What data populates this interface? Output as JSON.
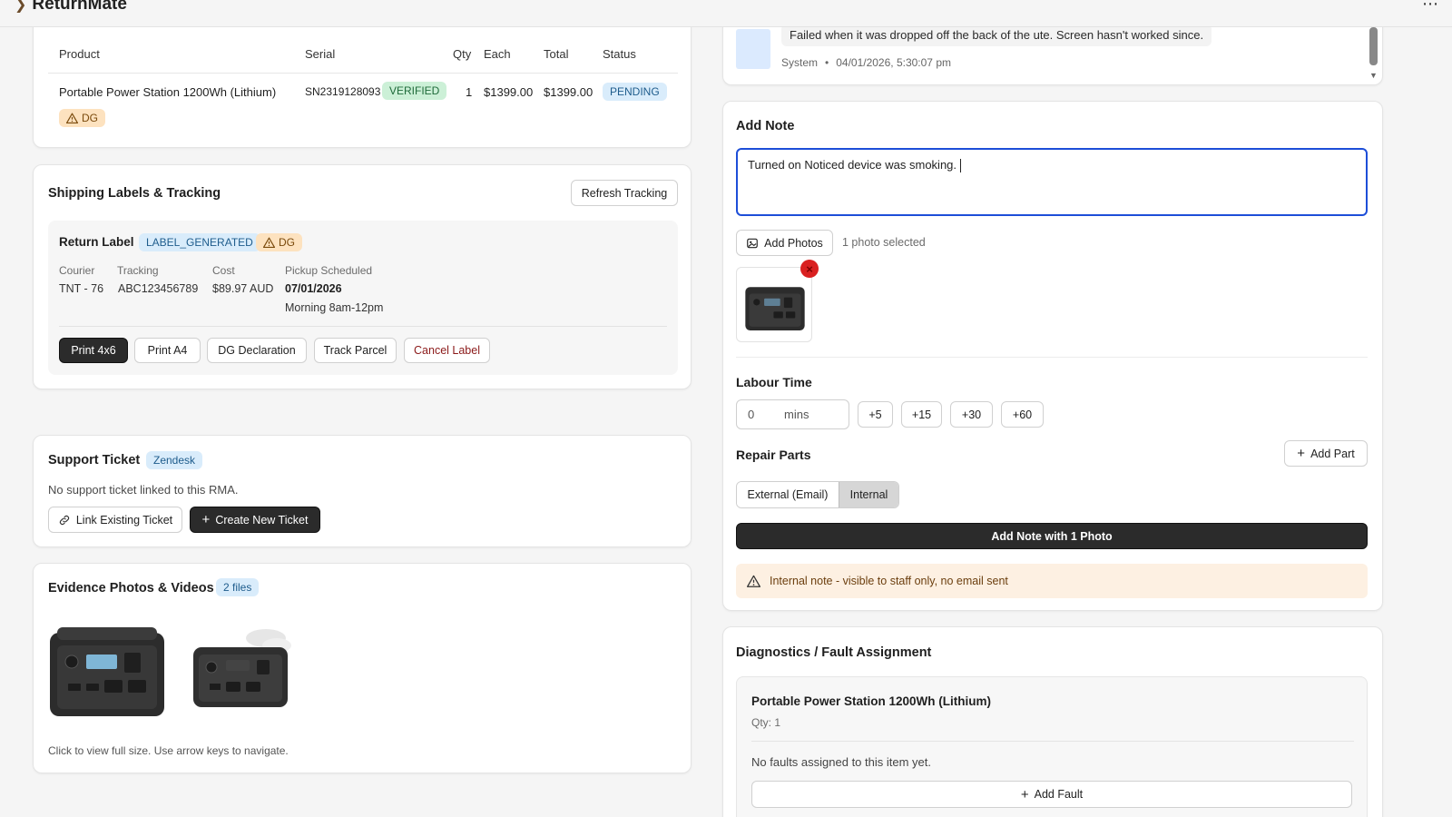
{
  "app": {
    "brand": "ReturnMate"
  },
  "products_table": {
    "headers": [
      "Product",
      "Serial",
      "Qty",
      "Each",
      "Total",
      "Status"
    ],
    "row": {
      "product": "Portable Power Station 1200Wh (Lithium)",
      "serial": "SN2319128093",
      "serial_badge": "VERIFIED",
      "qty": "1",
      "each": "$1399.00",
      "total": "$1399.00",
      "status": "PENDING",
      "dg_badge": "DG"
    }
  },
  "shipping": {
    "title": "Shipping Labels & Tracking",
    "refresh_label": "Refresh Tracking",
    "label_title": "Return Label",
    "label_status": "LABEL_GENERATED",
    "dg_badge": "DG",
    "courier_label": "Courier",
    "courier_value": "TNT - 76",
    "tracking_label": "Tracking",
    "tracking_value": "ABC123456789",
    "cost_label": "Cost",
    "cost_value": "$89.97 AUD",
    "pickup_label": "Pickup Scheduled",
    "pickup_date": "07/01/2026",
    "pickup_window": "Morning 8am-12pm",
    "buttons": {
      "print_4x6": "Print 4x6",
      "print_a4": "Print A4",
      "dg_declaration": "DG Declaration",
      "track_parcel": "Track Parcel",
      "cancel_label": "Cancel Label"
    },
    "cancel_color": "#8b1a1a"
  },
  "support": {
    "title": "Support Ticket",
    "badge": "Zendesk",
    "empty_text": "No support ticket linked to this RMA.",
    "link_label": "Link Existing Ticket",
    "create_label": "Create New Ticket"
  },
  "evidence": {
    "title": "Evidence Photos & Videos",
    "badge": "2 files",
    "hint": "Click to view full size. Use arrow keys to navigate."
  },
  "history": {
    "message": "Failed when it was dropped off the back of the ute. Screen hasn't worked since.",
    "author": "System",
    "separator": "•",
    "timestamp": "04/01/2026, 5:30:07 pm"
  },
  "add_note": {
    "title": "Add Note",
    "textarea_value": "Turned on Noticed device was smoking. ",
    "add_photos_label": "Add Photos",
    "photos_selected": "1 photo selected",
    "labour_title": "Labour Time",
    "labour_value": "0",
    "labour_unit": "mins",
    "increments": [
      "+5",
      "+15",
      "+30",
      "+60"
    ],
    "repair_parts_title": "Repair Parts",
    "add_part_label": "Add Part",
    "visibility_options": [
      "External (Email)",
      "Internal"
    ],
    "visibility_selected": "Internal",
    "submit_label": "Add Note with 1 Photo",
    "warning_text": "Internal note - visible to staff only, no email sent"
  },
  "diagnostics": {
    "title": "Diagnostics / Fault Assignment",
    "item_name": "Portable Power Station 1200Wh (Lithium)",
    "item_qty": "Qty: 1",
    "empty_text": "No faults assigned to this item yet.",
    "add_fault_label": "Add Fault"
  },
  "colors": {
    "accent_blue": "#1d4ed8",
    "dark_button": "#2b2b2b",
    "remove_red": "#d92020",
    "warning_bg": "#fdf0e2"
  }
}
